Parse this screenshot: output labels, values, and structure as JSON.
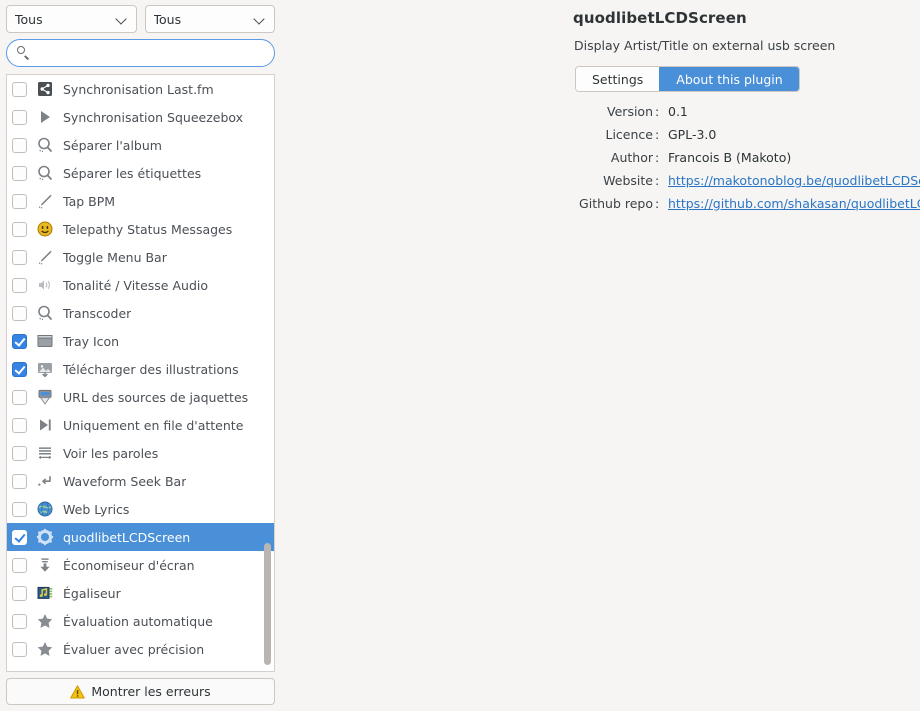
{
  "filters": {
    "category_all": "Tous",
    "status_all": "Tous"
  },
  "search": {
    "value": "",
    "placeholder": ""
  },
  "plugin_list": [
    {
      "label": "Synchronisation Last.fm",
      "checked": false,
      "selected": false,
      "icon": "share-lastfm-icon"
    },
    {
      "label": "Synchronisation Squeezebox",
      "checked": false,
      "selected": false,
      "icon": "play-triangle-icon"
    },
    {
      "label": "Séparer l'album",
      "checked": false,
      "selected": false,
      "icon": "magnifier-icon"
    },
    {
      "label": "Séparer les étiquettes",
      "checked": false,
      "selected": false,
      "icon": "magnifier-icon"
    },
    {
      "label": "Tap BPM",
      "checked": false,
      "selected": false,
      "icon": "pencil-icon"
    },
    {
      "label": "Telepathy Status Messages",
      "checked": false,
      "selected": false,
      "icon": "smiley-face-icon"
    },
    {
      "label": "Toggle Menu Bar",
      "checked": false,
      "selected": false,
      "icon": "pencil-icon"
    },
    {
      "label": "Tonalité / Vitesse Audio",
      "checked": false,
      "selected": false,
      "icon": "speaker-volume-icon"
    },
    {
      "label": "Transcoder",
      "checked": false,
      "selected": false,
      "icon": "magnifier-icon"
    },
    {
      "label": "Tray Icon",
      "checked": true,
      "selected": false,
      "icon": "window-tray-icon"
    },
    {
      "label": "Télécharger des illustrations",
      "checked": true,
      "selected": false,
      "icon": "image-download-icon"
    },
    {
      "label": "URL des sources de jaquettes",
      "checked": false,
      "selected": false,
      "icon": "screen-download-icon"
    },
    {
      "label": "Uniquement en file d'attente",
      "checked": false,
      "selected": false,
      "icon": "skip-forward-icon"
    },
    {
      "label": "Voir les paroles",
      "checked": false,
      "selected": false,
      "icon": "lyrics-lines-icon"
    },
    {
      "label": "Waveform Seek Bar",
      "checked": false,
      "selected": false,
      "icon": "seek-return-icon"
    },
    {
      "label": "Web Lyrics",
      "checked": false,
      "selected": false,
      "icon": "globe-icon"
    },
    {
      "label": "quodlibetLCDScreen",
      "checked": true,
      "selected": true,
      "icon": "gear-icon"
    },
    {
      "label": "Économiseur d'écran",
      "checked": false,
      "selected": false,
      "icon": "download-arrow-icon"
    },
    {
      "label": "Égaliseur",
      "checked": false,
      "selected": false,
      "icon": "equalizer-icon"
    },
    {
      "label": "Évaluation automatique",
      "checked": false,
      "selected": false,
      "icon": "star-icon"
    },
    {
      "label": "Évaluer avec précision",
      "checked": false,
      "selected": false,
      "icon": "star-icon"
    }
  ],
  "errors_button": {
    "label": "Montrer les erreurs"
  },
  "plugin_detail": {
    "title": "quodlibetLCDScreen",
    "description": "Display Artist/Title on external usb screen",
    "tabs": [
      {
        "label": "Settings",
        "active": false
      },
      {
        "label": "About this plugin",
        "active": true
      }
    ],
    "info": [
      {
        "label": "Version",
        "value": "0.1",
        "link": false
      },
      {
        "label": "Licence",
        "value": "GPL-3.0",
        "link": false
      },
      {
        "label": "Author",
        "value": "Francois B (Makoto)",
        "link": false
      },
      {
        "label": "Website",
        "value": "https://makotonoblog.be/quodlibetLCDScreen",
        "link": true
      },
      {
        "label": "Github repo",
        "value": "https://github.com/shakasan/quodlibetLCDScreen",
        "link": true
      }
    ],
    "colon": ":"
  },
  "colors": {
    "accent": "#4a90d9",
    "checkbox_accent": "#3584e4",
    "link": "#2a76c6",
    "panel_bg": "#f6f5f4",
    "list_bg": "#ffffff"
  }
}
